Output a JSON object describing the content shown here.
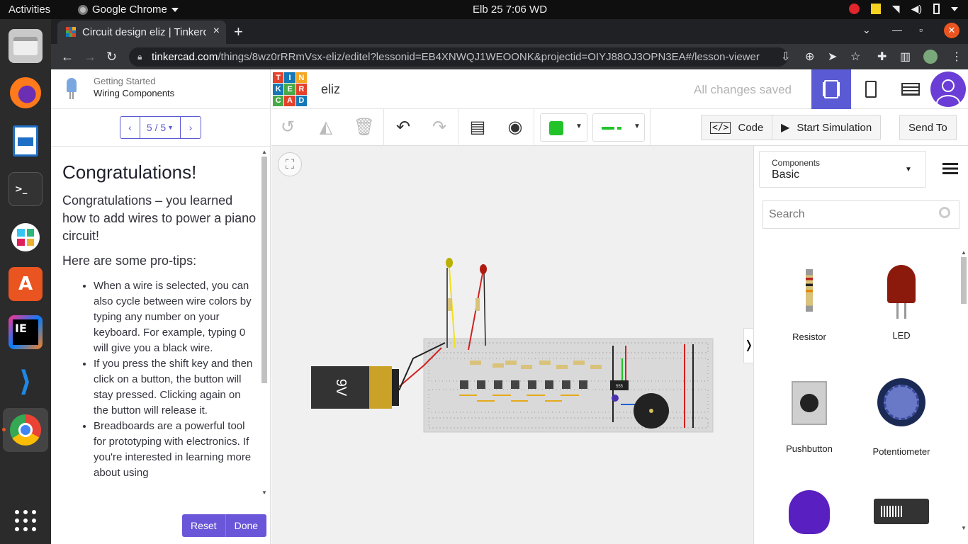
{
  "system": {
    "activities": "Activities",
    "app_name": "Google Chrome",
    "clock": "Elb 25  7:06 WD"
  },
  "browser": {
    "tab_title": "Circuit design eliz | Tinkerc",
    "url_domain": "tinkercad.com",
    "url_path": "/things/8wz0rRRmVsx-eliz/editel?lessonid=EB4XNWQJ1WEOONK&projectid=OIYJ88OJ3OPN3EA#/lesson-viewer"
  },
  "lesson": {
    "category": "Getting Started",
    "name": "Wiring Components",
    "page": "5 / 5",
    "heading": "Congratulations!",
    "intro": "Congratulations – you learned how to add wires to power a piano circuit!",
    "protips_heading": "Here are some pro-tips:",
    "tips": [
      "When a wire is selected, you can also cycle between wire colors by typing any number on your keyboard. For example, typing 0 will give you a black wire.",
      "If you press the shift key and then click on a button, the button will stay pressed. Clicking again on the button will release it.",
      "Breadboards are a powerful tool for prototyping with electronics. If you're interested in learning more about using"
    ],
    "reset_label": "Reset",
    "done_label": "Done"
  },
  "tinkercad": {
    "logo_letters": [
      "T",
      "I",
      "N",
      "K",
      "E",
      "R",
      "C",
      "A",
      "D"
    ],
    "logo_colors": [
      "#e4412b",
      "#1478b7",
      "#f5a623",
      "#1478b7",
      "#48a947",
      "#e4412b",
      "#48a947",
      "#e4412b",
      "#1478b7"
    ],
    "project_name": "eliz",
    "save_status": "All changes saved",
    "code_label": "Code",
    "sim_label": "Start Simulation",
    "send_label": "Send To",
    "wire_color": "#22c32a",
    "accent": "#5a5bd4"
  },
  "components": {
    "dropdown_label": "Components",
    "dropdown_value": "Basic",
    "search_placeholder": "Search",
    "items": [
      {
        "label": "Resistor"
      },
      {
        "label": "LED"
      },
      {
        "label": "Pushbutton"
      },
      {
        "label": "Potentiometer"
      }
    ]
  },
  "circuit": {
    "battery_label": "9V",
    "chip_label": "555"
  }
}
